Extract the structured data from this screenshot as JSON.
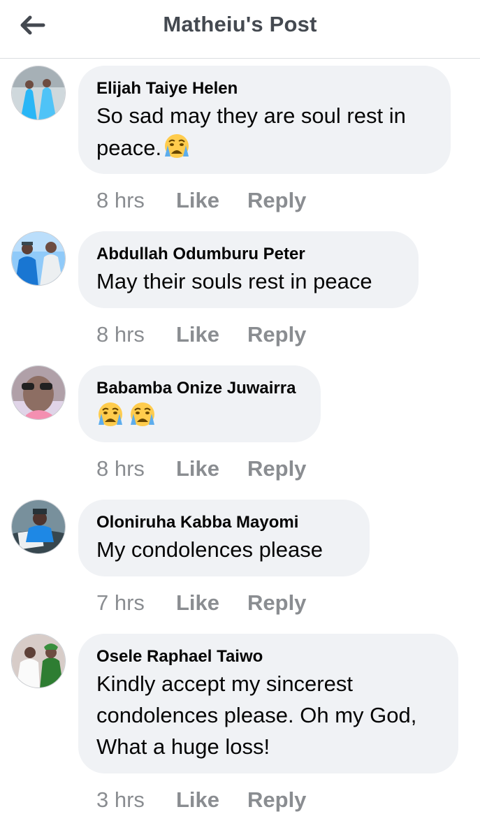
{
  "header": {
    "title": "Matheiu's Post"
  },
  "actions": {
    "like_label": "Like",
    "reply_label": "Reply"
  },
  "colors": {
    "bubble_bg": "#f0f2f5",
    "muted_text": "#8a8d91",
    "title_text": "#444950"
  },
  "comments": [
    {
      "author": "Elijah Taiye Helen",
      "text": "So sad may they are soul rest in peace.",
      "emoji": [
        "crying-face"
      ],
      "time": "8 hrs"
    },
    {
      "author": "Abdullah Odumburu Peter",
      "text": "May their souls rest in peace",
      "emoji": [],
      "time": "8 hrs"
    },
    {
      "author": "Babamba Onize Juwairra",
      "text": "",
      "emoji": [
        "crying-face",
        "crying-face"
      ],
      "time": "8 hrs"
    },
    {
      "author": "Oloniruha Kabba Mayomi",
      "text": "My condolences please",
      "emoji": [],
      "time": "7 hrs"
    },
    {
      "author": "Osele Raphael Taiwo",
      "text": "Kindly accept my sincerest condolences please. Oh my God, What a huge loss!",
      "emoji": [],
      "time": "3 hrs"
    }
  ]
}
